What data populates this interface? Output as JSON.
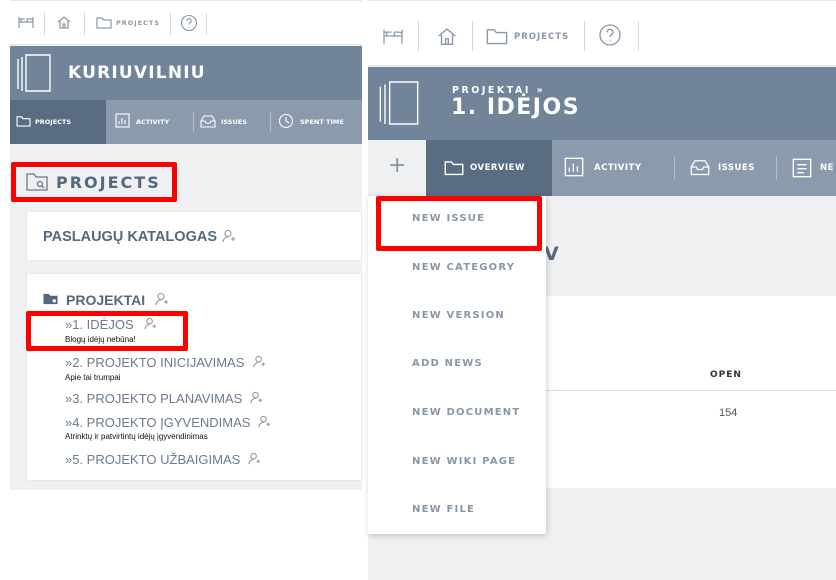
{
  "left": {
    "topbar": {
      "projects_label": "PROJECTS"
    },
    "brand": {
      "title": "KURIUVILNIU"
    },
    "tabs": [
      {
        "label": "PROJECTS"
      },
      {
        "label": "ACTIVITY"
      },
      {
        "label": "ISSUES"
      },
      {
        "label": "SPENT TIME"
      }
    ],
    "page_title": "PROJECTS",
    "catalog": {
      "title": "PASLAUGŲ KATALOGAS"
    },
    "group": {
      "title": "PROJEKTAI",
      "items": [
        {
          "label": "»1. IDĖJOS",
          "desc": "Blogų idėjų nebūna!"
        },
        {
          "label": "»2. PROJEKTO INICIJAVIMAS",
          "desc": "Apie tai trumpai"
        },
        {
          "label": "»3. PROJEKTO PLANAVIMAS",
          "desc": ""
        },
        {
          "label": "»4. PROJEKTO ĮGYVENDIMAS",
          "desc": "Atrinktų ir patvirtintų idėjų įgyvendinimas"
        },
        {
          "label": "»5. PROJEKTO UŽBAIGIMAS",
          "desc": ""
        }
      ]
    }
  },
  "right": {
    "topbar": {
      "projects_label": "PROJECTS"
    },
    "header": {
      "breadcrumb": "PROJEKTAI »",
      "title": "1. IDĖJOS"
    },
    "plus": "+",
    "tabs": [
      {
        "label": "OVERVIEW"
      },
      {
        "label": "ACTIVITY"
      },
      {
        "label": "ISSUES"
      },
      {
        "label": "NE"
      }
    ],
    "menu": [
      {
        "label": "NEW ISSUE"
      },
      {
        "label": "NEW CATEGORY"
      },
      {
        "label": "NEW VERSION"
      },
      {
        "label": "ADD NEWS"
      },
      {
        "label": "NEW DOCUMENT"
      },
      {
        "label": "NEW WIKI PAGE"
      },
      {
        "label": "NEW FILE"
      }
    ],
    "bg_title_fragment": "V",
    "table": {
      "open_header": "OPEN",
      "open_value": "154"
    }
  },
  "colors": {
    "header_slate": "#71849a",
    "tab_slate": "#8b9aad",
    "active_tab": "#5a6c81",
    "highlight": "#ff0000",
    "panel_bg": "#eef0f2"
  }
}
